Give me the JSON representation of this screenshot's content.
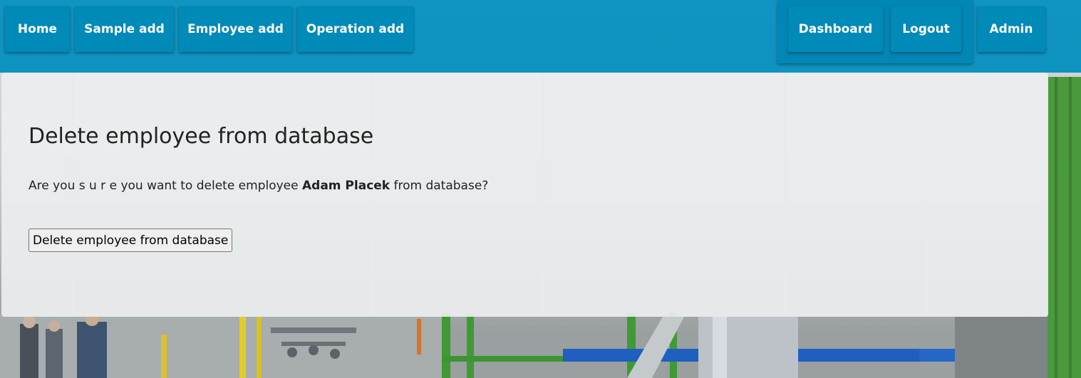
{
  "nav": {
    "left_items": [
      {
        "label": "Home"
      },
      {
        "label": "Sample add"
      },
      {
        "label": "Employee add"
      },
      {
        "label": "Operation add"
      }
    ],
    "right_items": [
      {
        "label": "Dashboard"
      },
      {
        "label": "Logout"
      },
      {
        "label": "Admin"
      }
    ]
  },
  "main": {
    "title": "Delete employee from database",
    "confirm_prefix": "Are you s u r e you want to delete employee ",
    "employee_name": "Adam Placek",
    "confirm_suffix": " from database?",
    "delete_button_label": "Delete employee from database"
  },
  "colors": {
    "navbar": "#008ebe",
    "nav_button": "#008ab8",
    "panel": "#eceef0"
  }
}
